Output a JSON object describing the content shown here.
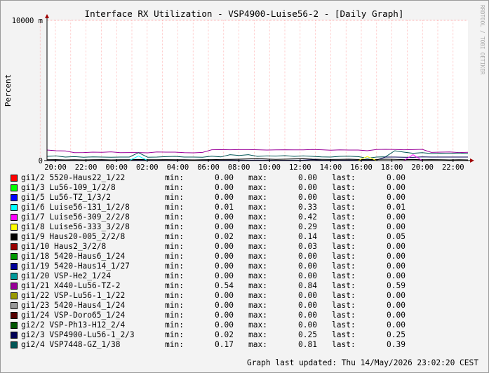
{
  "chart_data": {
    "type": "line",
    "title": "Interface RX Utilization - VSP4900-Luise56-2 - [Daily Graph]",
    "ylabel": "Percent",
    "ylim": [
      0,
      10000
    ],
    "y_unit": "m",
    "yticks": [
      "0",
      "10000 m"
    ],
    "x_tick_labels": [
      "20:00",
      "22:00",
      "00:00",
      "02:00",
      "04:00",
      "06:00",
      "08:00",
      "10:00",
      "12:00",
      "14:00",
      "16:00",
      "18:00",
      "20:00",
      "22:00"
    ],
    "watermark": "RRDTOOL / TOBI OETIKER",
    "grid": true,
    "legend_placement": "bottom",
    "series": [
      {
        "name": "gi1/2 5520-Haus22_1/22",
        "color": "#ff0000",
        "min": "0.00",
        "max": "0.00",
        "last": "0.00"
      },
      {
        "name": "gi1/3 Lu56-109_1/2/8",
        "color": "#00ff00",
        "min": "0.00",
        "max": "0.00",
        "last": "0.00"
      },
      {
        "name": "gi1/5 Lu56-TZ_1/3/2",
        "color": "#0000ff",
        "min": "0.00",
        "max": "0.00",
        "last": "0.00"
      },
      {
        "name": "gi1/6 Luise56-131_1/2/8",
        "color": "#00ffff",
        "min": "0.01",
        "max": "0.33",
        "last": "0.01"
      },
      {
        "name": "gi1/7 Luise56-309_2/2/8",
        "color": "#ff00ff",
        "min": "0.00",
        "max": "0.42",
        "last": "0.00"
      },
      {
        "name": "gi1/8 Luise56-333_3/2/8",
        "color": "#ffff00",
        "min": "0.00",
        "max": "0.29",
        "last": "0.00"
      },
      {
        "name": "gi1/9 Haus20-005_2/2/8",
        "color": "#000000",
        "min": "0.02",
        "max": "0.14",
        "last": "0.05"
      },
      {
        "name": "gi1/10 Haus2_3/2/8",
        "color": "#990000",
        "min": "0.00",
        "max": "0.03",
        "last": "0.00"
      },
      {
        "name": "gi1/18 5420-Haus6_1/24",
        "color": "#009900",
        "min": "0.00",
        "max": "0.00",
        "last": "0.00"
      },
      {
        "name": "gi1/19 5420-Haus14_1/27",
        "color": "#000099",
        "min": "0.00",
        "max": "0.00",
        "last": "0.00"
      },
      {
        "name": "gi1/20 VSP-He2_1/24",
        "color": "#009999",
        "min": "0.00",
        "max": "0.00",
        "last": "0.00"
      },
      {
        "name": "gi1/21 X440-Lu56-TZ-2",
        "color": "#990099",
        "min": "0.54",
        "max": "0.84",
        "last": "0.59"
      },
      {
        "name": "gi1/22 VSP-Lu56-1_1/22",
        "color": "#999900",
        "min": "0.00",
        "max": "0.00",
        "last": "0.00"
      },
      {
        "name": "gi1/23 5420-Haus4_1/24",
        "color": "#999999",
        "min": "0.00",
        "max": "0.00",
        "last": "0.00"
      },
      {
        "name": "gi1/24 VSP-Doro65_1/24",
        "color": "#550000",
        "min": "0.00",
        "max": "0.00",
        "last": "0.00"
      },
      {
        "name": "gi2/2 VSP-Ph13-H12_2/4",
        "color": "#005500",
        "min": "0.00",
        "max": "0.00",
        "last": "0.00"
      },
      {
        "name": "gi2/3 VSP4900-Lu56-1_2/3",
        "color": "#000055",
        "min": "0.02",
        "max": "0.25",
        "last": "0.25"
      },
      {
        "name": "gi2/4 VSP7448-GZ_1/38",
        "color": "#005555",
        "min": "0.17",
        "max": "0.81",
        "last": "0.39"
      }
    ],
    "plotted_series": [
      {
        "name": "gi1/21 X440-Lu56-TZ-2",
        "color": "#990099",
        "values": [
          750,
          700,
          690,
          560,
          570,
          600,
          590,
          620,
          560,
          570,
          570,
          550,
          610,
          600,
          600,
          560,
          550,
          580,
          770,
          780,
          770,
          780,
          780,
          770,
          750,
          760,
          770,
          760,
          760,
          790,
          770,
          740,
          760,
          750,
          750,
          700,
          790,
          800,
          790,
          770,
          780,
          800,
          580,
          600,
          610,
          570,
          590
        ]
      },
      {
        "name": "gi2/4 VSP7448-GZ_1/38",
        "color": "#005555",
        "values": [
          300,
          330,
          250,
          280,
          240,
          260,
          250,
          240,
          250,
          250,
          560,
          240,
          250,
          280,
          300,
          250,
          250,
          240,
          310,
          260,
          420,
          360,
          420,
          300,
          330,
          320,
          350,
          300,
          330,
          300,
          260,
          250,
          300,
          310,
          280,
          170,
          250,
          270,
          700,
          600,
          520,
          560,
          500,
          520,
          510,
          540,
          500
        ]
      },
      {
        "name": "gi2/3 VSP4900-Lu56-1_2/3",
        "color": "#000055",
        "values": [
          20,
          30,
          25,
          20,
          20,
          25,
          30,
          30,
          20,
          20,
          30,
          40,
          30,
          20,
          25,
          20,
          20,
          25,
          30,
          25,
          40,
          30,
          30,
          35,
          30,
          25,
          25,
          30,
          35,
          60,
          30,
          25,
          30,
          40,
          30,
          30,
          40,
          250,
          250,
          240,
          230,
          260,
          250,
          250,
          250,
          250,
          250
        ]
      },
      {
        "name": "gi1/9 Haus20-005_2/2/8",
        "color": "#000000",
        "values": [
          60,
          70,
          50,
          60,
          50,
          60,
          70,
          50,
          60,
          60,
          80,
          60,
          60,
          70,
          60,
          60,
          50,
          60,
          70,
          80,
          90,
          100,
          120,
          140,
          110,
          90,
          100,
          120,
          130,
          100,
          90,
          80,
          90,
          100,
          80,
          70,
          80,
          100,
          90,
          70,
          80,
          60,
          70,
          60,
          50,
          60,
          50
        ]
      },
      {
        "name": "gi1/7 Luise56-309_2/2/8",
        "color": "#ff00ff",
        "values": [
          0,
          0,
          0,
          0,
          0,
          0,
          0,
          0,
          0,
          0,
          0,
          0,
          0,
          0,
          0,
          0,
          0,
          0,
          0,
          0,
          0,
          0,
          0,
          0,
          0,
          0,
          0,
          0,
          0,
          0,
          0,
          0,
          0,
          0,
          0,
          0,
          0,
          0,
          0,
          0,
          420,
          0,
          0,
          0,
          0,
          0,
          0
        ]
      },
      {
        "name": "gi1/6 Luise56-131_1/2/8",
        "color": "#00ffff",
        "values": [
          0,
          0,
          0,
          0,
          0,
          0,
          0,
          0,
          0,
          0,
          330,
          0,
          0,
          0,
          0,
          0,
          0,
          0,
          0,
          0,
          0,
          0,
          0,
          0,
          0,
          0,
          0,
          0,
          0,
          0,
          0,
          0,
          0,
          0,
          0,
          0,
          0,
          0,
          0,
          0,
          0,
          0,
          0,
          0,
          0,
          0,
          0
        ]
      },
      {
        "name": "gi1/8 Luise56-333_3/2/8",
        "color": "#ffff00",
        "values": [
          0,
          0,
          0,
          0,
          0,
          0,
          0,
          0,
          0,
          0,
          0,
          0,
          0,
          0,
          0,
          0,
          0,
          0,
          0,
          0,
          0,
          0,
          0,
          0,
          0,
          0,
          0,
          0,
          0,
          0,
          0,
          0,
          0,
          0,
          0,
          290,
          0,
          0,
          0,
          0,
          0,
          0,
          0,
          0,
          0,
          0,
          0
        ]
      }
    ]
  },
  "labels": {
    "min": "min:",
    "max": "max:",
    "last": "last:"
  },
  "footer": {
    "updated": "Graph last updated: Thu 14/May/2026 23:02:20 CEST"
  }
}
